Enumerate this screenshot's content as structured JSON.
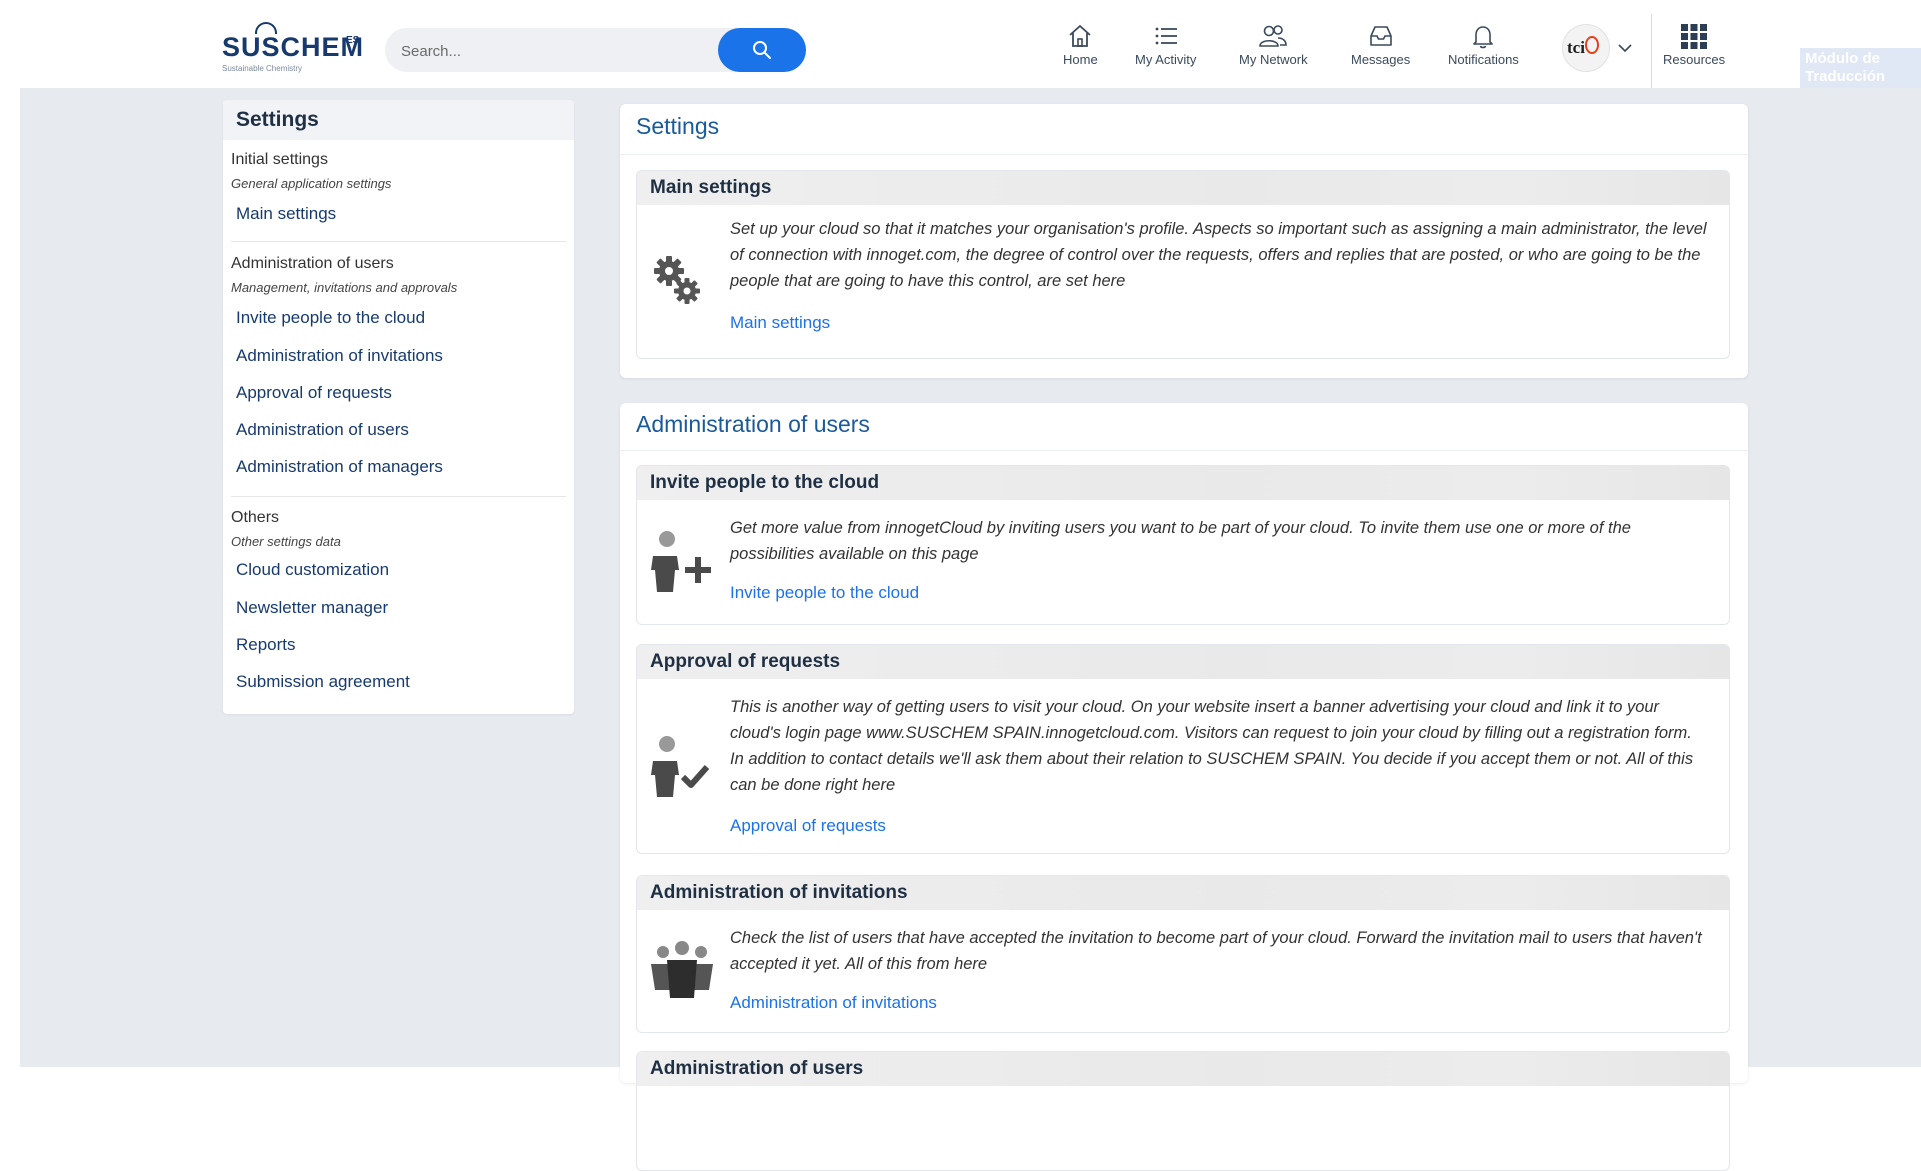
{
  "colors": {
    "brand_navy": "#173a6e",
    "accent_blue": "#1a73e8",
    "page_background": "#e7ebf0",
    "panel_title": "#1a5a9a",
    "avatar_accent": "#e2401c"
  },
  "header": {
    "logo": {
      "text": "SUSCHEM",
      "superscript": "ES",
      "tagline": "Sustainable Chemistry"
    },
    "search": {
      "placeholder": "Search...",
      "icon": "search-icon"
    },
    "nav": [
      {
        "label": "Home",
        "icon": "home-icon"
      },
      {
        "label": "My Activity",
        "icon": "list-icon"
      },
      {
        "label": "My Network",
        "icon": "people-icon"
      },
      {
        "label": "Messages",
        "icon": "inbox-icon"
      },
      {
        "label": "Notifications",
        "icon": "bell-icon"
      }
    ],
    "avatar": {
      "text": "tci",
      "icon": "chevron-down-icon"
    },
    "resources": {
      "label": "Resources",
      "icon": "grid-icon"
    },
    "translation_badge": {
      "line1": "Módulo de",
      "line2": "Traducción"
    }
  },
  "sidebar": {
    "title": "Settings",
    "groups": [
      {
        "title": "Initial settings",
        "subtitle": "General application settings",
        "links": [
          "Main settings"
        ]
      },
      {
        "title": "Administration of users",
        "subtitle": "Management, invitations and approvals",
        "links": [
          "Invite people to the cloud",
          "Administration of invitations",
          "Approval of requests",
          "Administration of users",
          "Administration of managers"
        ]
      },
      {
        "title": "Others",
        "subtitle": "Other settings data",
        "links": [
          "Cloud customization",
          "Newsletter manager",
          "Reports",
          "Submission agreement"
        ]
      }
    ]
  },
  "main": {
    "settings_panel": {
      "title": "Settings",
      "cards": [
        {
          "title": "Main settings",
          "icon": "gears-icon",
          "text": "Set up your cloud so that it matches your organisation's profile. Aspects so important such as assigning a main administrator, the level of connection with innoget.com, the degree of control over the requests, offers and replies that are posted, or who are going to be the people that are going to have this control, are set here",
          "link": "Main settings"
        }
      ]
    },
    "users_panel": {
      "title": "Administration of users",
      "cards": [
        {
          "title": "Invite people to the cloud",
          "icon": "add-user-icon",
          "text": "Get more value from innogetCloud by inviting users you want to be part of your cloud. To invite them use one or more of the possibilities available on this page",
          "link": "Invite people to the cloud"
        },
        {
          "title": "Approval of requests",
          "icon": "approve-user-icon",
          "text": "This is another way of getting users to visit your cloud. On your website insert a banner advertising your cloud and link it to your cloud's login page www.SUSCHEM SPAIN.innogetcloud.com. Visitors can request to join your cloud by filling out a registration form. In addition to contact details we'll ask them about their relation to SUSCHEM SPAIN. You decide if you accept them or not. All of this can be done right here",
          "link": "Approval of requests"
        },
        {
          "title": "Administration of invitations",
          "icon": "group-icon",
          "text": "Check the list of users that have accepted the invitation to become part of your cloud. Forward the invitation mail to users that haven't accepted it yet. All of this from here",
          "link": "Administration of invitations"
        },
        {
          "title": "Administration of users"
        }
      ]
    }
  }
}
